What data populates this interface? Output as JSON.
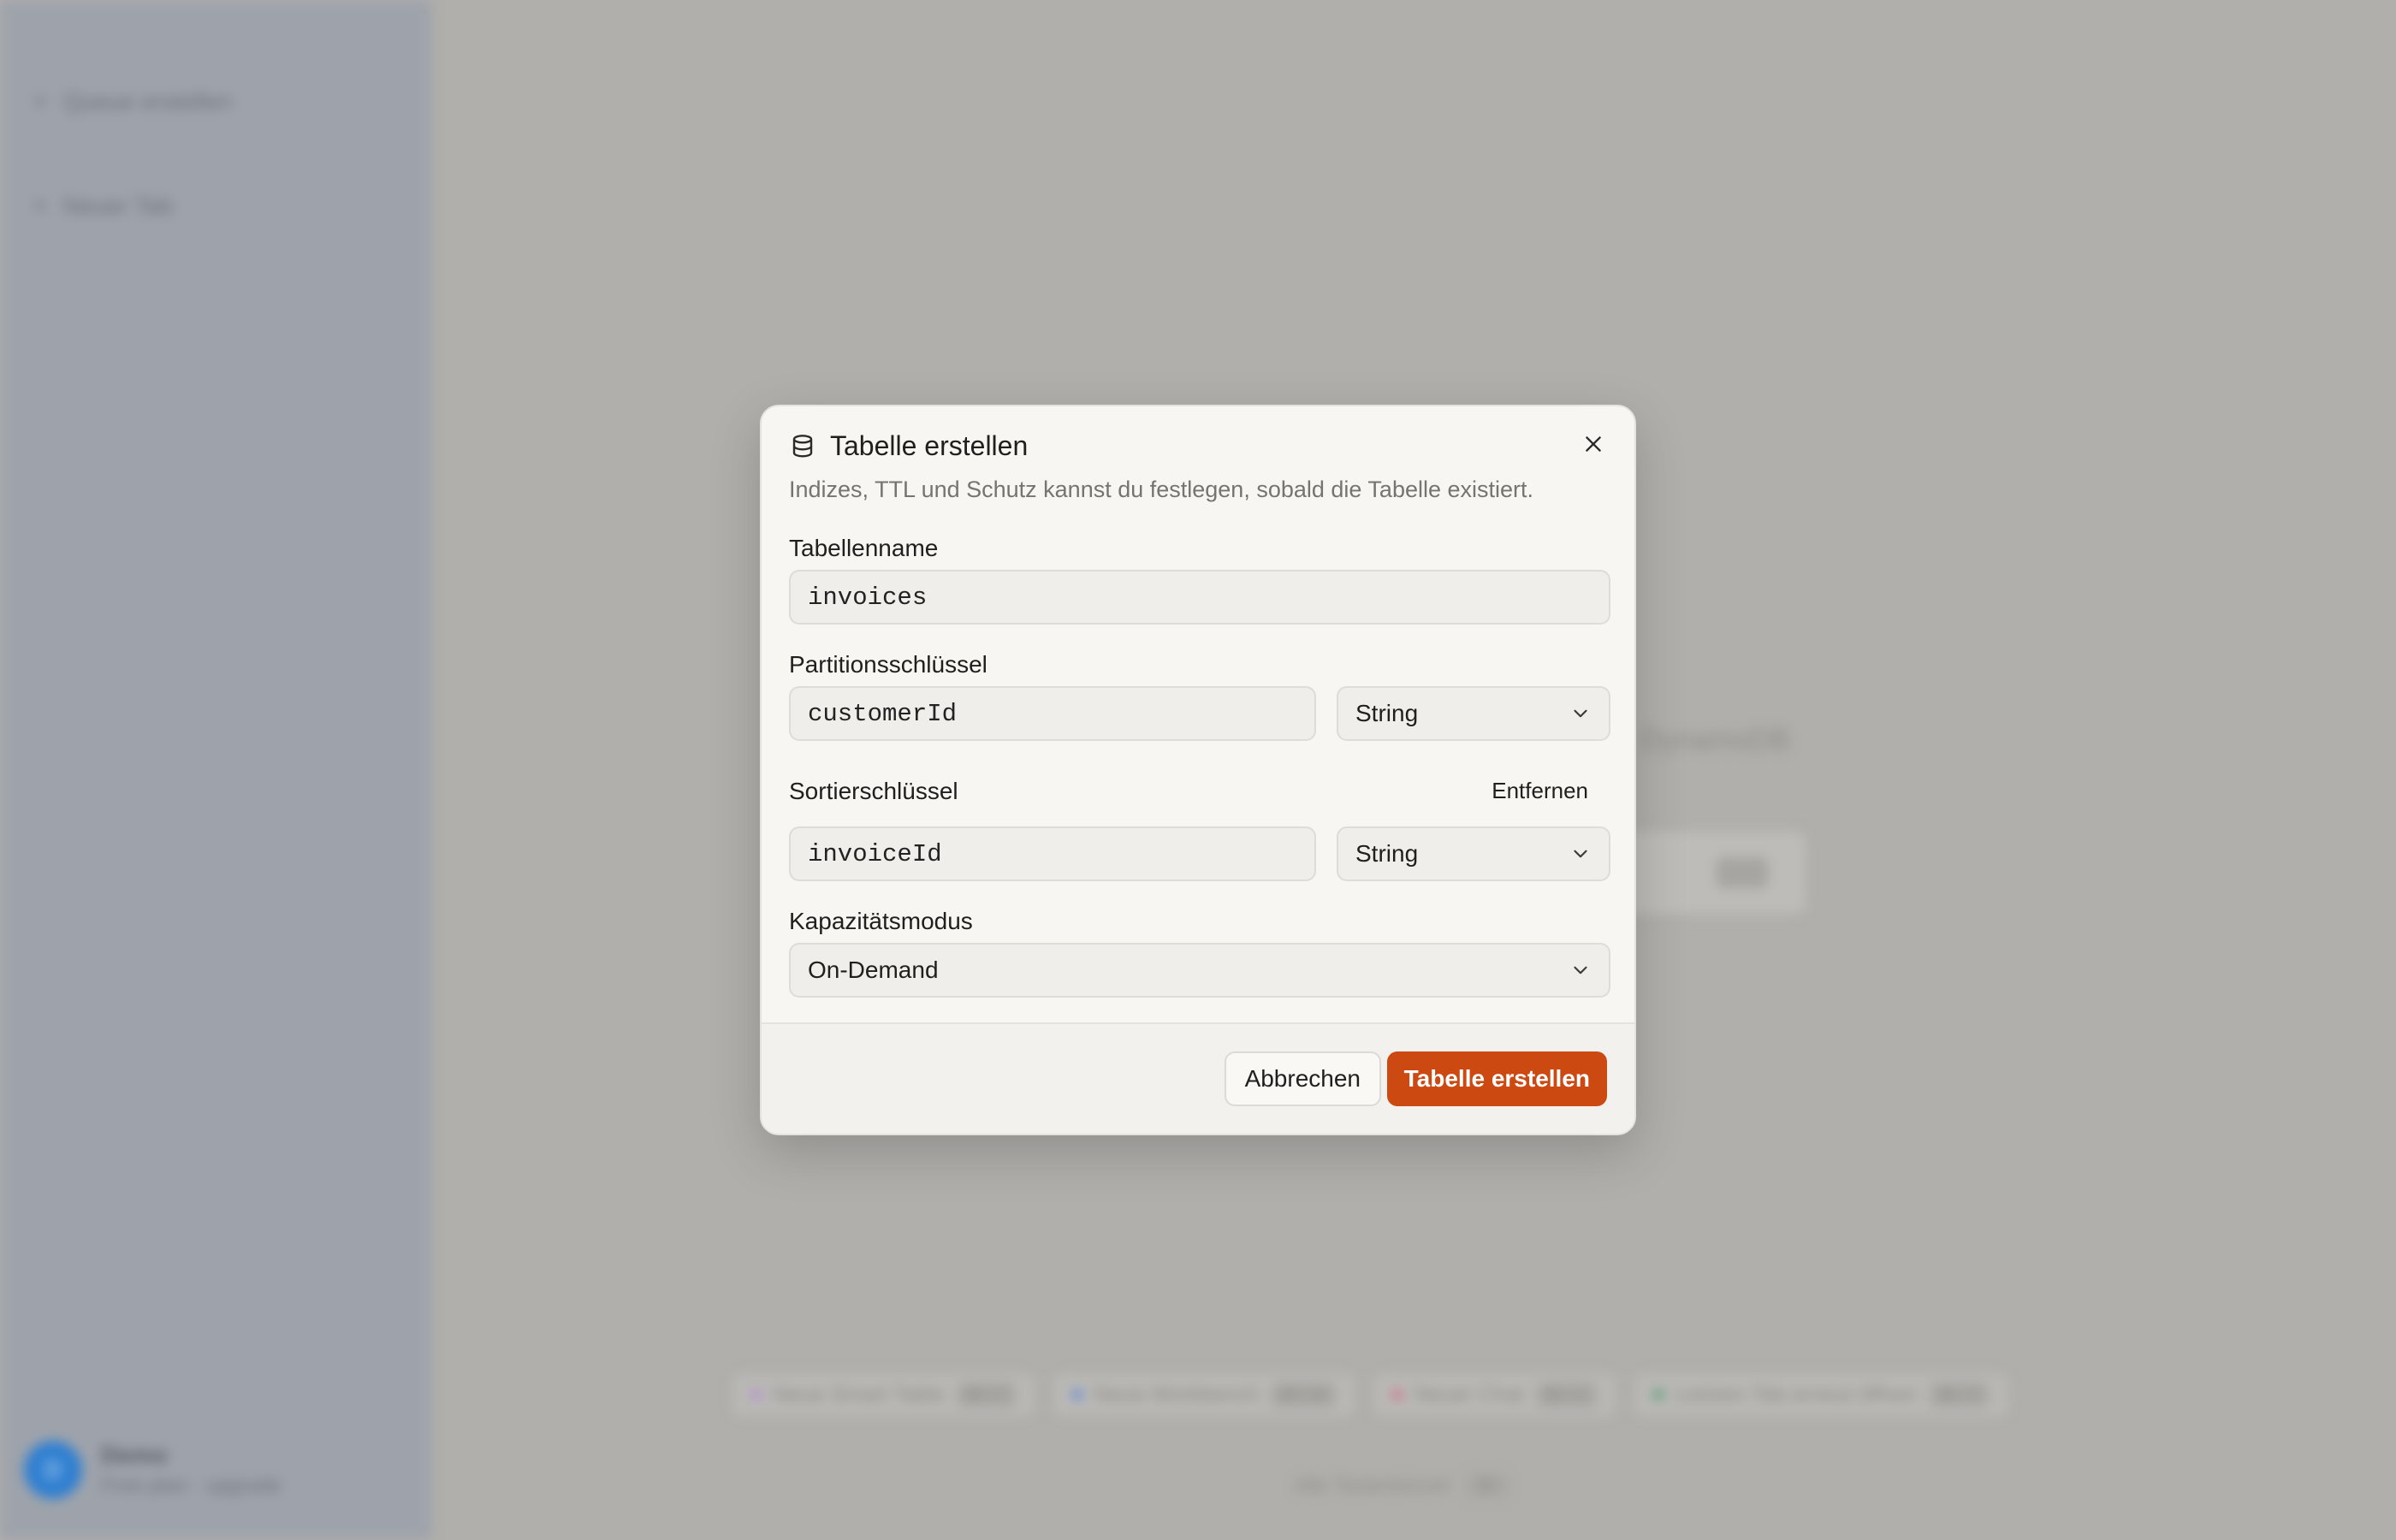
{
  "background": {
    "sidebar": {
      "items": [
        {
          "label": "Queue erstellen",
          "icon": "plus-icon"
        },
        {
          "label": "Neuer Tab",
          "icon": "plus-icon"
        }
      ],
      "user": {
        "initial": "D",
        "name": "Demo",
        "subtitle": "Free plan · upgrade"
      }
    },
    "brand_text": "DynamoDB",
    "quick_actions": [
      {
        "label": "Neue Smart Table",
        "shortcut": "⌘⇧T",
        "color": "#b78bd0"
      },
      {
        "label": "Neue Workbench",
        "shortcut": "⌘⇧W",
        "color": "#5f86d6"
      },
      {
        "label": "Neuer Chat",
        "shortcut": "⌘⇧C",
        "color": "#d06a8a"
      },
      {
        "label": "Letzten Tab erneut öffnen",
        "shortcut": "⌘⇧T",
        "color": "#4f9a6e"
      }
    ],
    "hint": {
      "label": "Alle Tastenkürzel",
      "key": "⌘/"
    }
  },
  "modal": {
    "title": "Tabelle erstellen",
    "description": "Indizes, TTL und Schutz kannst du festlegen, sobald die Tabelle existiert.",
    "table_name": {
      "label": "Tabellenname",
      "value": "invoices"
    },
    "partition_key": {
      "label": "Partitionsschlüssel",
      "value": "customerId",
      "type": "String"
    },
    "sort_key": {
      "label": "Sortierschlüssel",
      "value": "invoiceId",
      "type": "String",
      "remove_label": "Entfernen"
    },
    "capacity": {
      "label": "Kapazitätsmodus",
      "value": "On-Demand"
    },
    "cancel_label": "Abbrechen",
    "submit_label": "Tabelle erstellen"
  },
  "colors": {
    "accent": "#cc4a12",
    "avatar": "#2f7fd1"
  }
}
